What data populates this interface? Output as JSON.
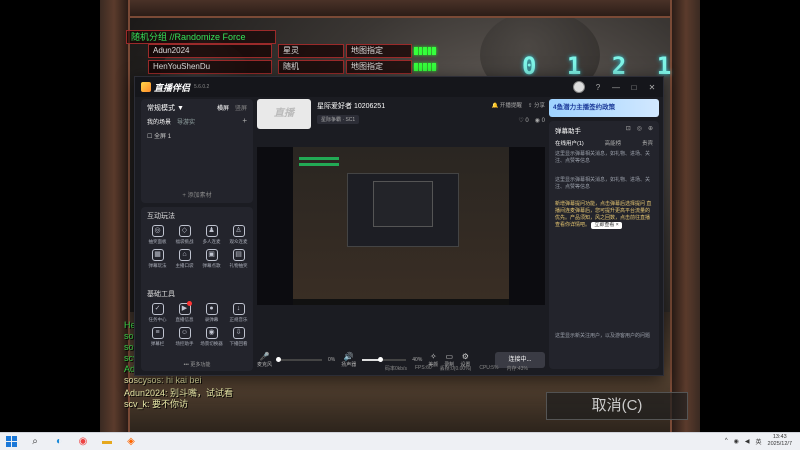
{
  "game": {
    "force_label": "随机分组 //Randomize Force",
    "players": [
      {
        "name": "Adun2024",
        "race": "星灵",
        "map": "地图指定"
      },
      {
        "name": "HenYouShenDu",
        "race": "随机",
        "map": "地图指定"
      }
    ],
    "countdown": "0 1 2 1",
    "chat": [
      {
        "text": "He",
        "style": "green"
      },
      {
        "text": "sos",
        "style": "green"
      },
      {
        "text": "sos",
        "style": "green"
      },
      {
        "text": "scv",
        "style": "green"
      },
      {
        "text": "Ad",
        "style": "green"
      },
      {
        "text": "soscysos: hi kai bei",
        "style": "yellow"
      },
      {
        "text": "Adun2024: 别斗嘴，试试看",
        "style": "yellow"
      },
      {
        "text": "scv_k: 要不你访",
        "style": "yellow"
      }
    ],
    "cancel_label": "取消(C)"
  },
  "app": {
    "name": "直播伴侣",
    "version": "5.6.0.2",
    "titlebar_icons": [
      "?",
      "—",
      "□",
      "✕"
    ],
    "left": {
      "mode": "常规模式 ▼",
      "orientation_tabs": [
        "横屏",
        "竖屏"
      ],
      "scene_tabs": [
        "我的场景",
        "导游实"
      ],
      "scene_add": "+",
      "scene_item": "全屏 1",
      "add_source": "+ 添加素材",
      "interaction_title": "互动玩法",
      "interaction_tools": [
        {
          "icon": "gift-icon",
          "glyph": "◎",
          "label": "抽奖面板"
        },
        {
          "icon": "shield-icon",
          "glyph": "◇",
          "label": "福袋挑战"
        },
        {
          "icon": "users-icon",
          "glyph": "♟",
          "label": "多人连麦"
        },
        {
          "icon": "user-add-icon",
          "glyph": "♙",
          "label": "观众连麦"
        },
        {
          "icon": "game-icon",
          "glyph": "▦",
          "label": "弹幕玩法"
        },
        {
          "icon": "store-icon",
          "glyph": "⌂",
          "label": "主播口袋"
        },
        {
          "icon": "gamepad-icon",
          "glyph": "▣",
          "label": "弹幕点歌"
        },
        {
          "icon": "calendar-icon",
          "glyph": "▤",
          "label": "礼物抽奖"
        }
      ],
      "basic_title": "基础工具",
      "basic_tools": [
        {
          "icon": "task-icon",
          "glyph": "✓",
          "label": "任务中心",
          "badge": false
        },
        {
          "icon": "live-icon",
          "glyph": "▶",
          "label": "直播信息",
          "badge": true
        },
        {
          "icon": "record-icon",
          "glyph": "●",
          "label": "录弹幕",
          "badge": false
        },
        {
          "icon": "download-icon",
          "glyph": "↓",
          "label": "正规音乐",
          "badge": false
        },
        {
          "icon": "danmu-icon",
          "glyph": "≡",
          "label": "弹幕栏",
          "badge": false
        },
        {
          "icon": "helper-icon",
          "glyph": "☺",
          "label": "场控助手",
          "badge": false
        },
        {
          "icon": "record2-icon",
          "glyph": "◉",
          "label": "场景切换器",
          "badge": false
        },
        {
          "icon": "download2-icon",
          "glyph": "⇩",
          "label": "下播回看",
          "badge": false
        }
      ],
      "more_features": "••• 更多功能"
    },
    "center": {
      "room_thumb": "直播",
      "room_title": "星际爱好者 10206251",
      "room_tag": "星际争霸 · SC1",
      "actions": [
        "开播提醒",
        "分享"
      ],
      "stats": [
        "0",
        "0"
      ],
      "mic_label": "麦克风",
      "mic_pct": "0%",
      "mic_level": 0,
      "sound_label": "扬声器",
      "sound_pct": "40%",
      "sound_level": 0.4,
      "tools": [
        {
          "icon": "beauty-icon",
          "glyph": "✧",
          "label": "美颜"
        },
        {
          "icon": "effects-icon",
          "glyph": "▭",
          "label": "录制"
        },
        {
          "icon": "settings-icon",
          "glyph": "⚙",
          "label": "设置"
        }
      ],
      "go_live": "连接中...",
      "status": [
        "码率0kb/s",
        "FPS:60",
        "丢帧:0(0.00%)",
        "CPU:5%",
        "内存:43%"
      ]
    },
    "right": {
      "promo": "4鱼潜力主播签约政策",
      "header": "弹幕助手",
      "header_icons": [
        "⊡",
        "◎",
        "⊕"
      ],
      "tabs": [
        "在线用户(1)",
        "高能榜",
        "贵宾"
      ],
      "text1": "这里显示弹幕相关消息，如礼物、进场、关注、点赞等信息",
      "text2": "这里显示弹幕相关消息，如礼物、进场、关注、点赞等信息",
      "highlight": "新增弹幕提问功能，点击弹幕后选择提问 直播间连麦弹幕后，您可提升更高平台流量的优先。产品须知，风之回数，点击前往直播查看你详情吧。",
      "highlight_btn": "立即查看 ×",
      "text3": "这里显示新关注用户，以及游客用户的问题"
    }
  },
  "taskbar": {
    "icons": [
      "start-icon",
      "search-icon",
      "edge-icon",
      "chrome-icon",
      "files-icon",
      "douyu-icon"
    ],
    "tray": [
      "^",
      "◉",
      "◀",
      "英"
    ],
    "time": "13:43",
    "date": "2025/12/7"
  }
}
